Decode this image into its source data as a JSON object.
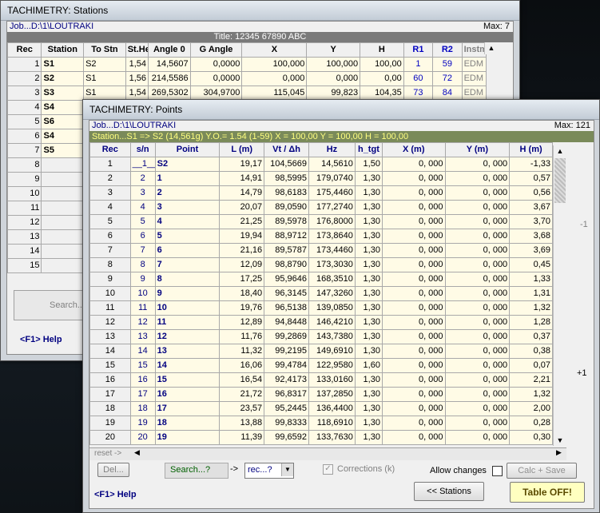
{
  "stations_window": {
    "title": "TACHIMETRY: Stations",
    "job": "Job...D:\\1\\LOUTRAKI",
    "max": "Max: 7",
    "title_line": "Title:  12345 67890 ABC",
    "headers": [
      "Rec",
      "Station",
      "To Stn",
      "St.He",
      "Angle 0",
      "G Angle",
      "X",
      "Y",
      "H",
      "R1",
      "R2",
      "Instm"
    ],
    "rows": [
      {
        "rec": "1",
        "station": "S1",
        "to_stn": "S2",
        "st_he": "1,54",
        "angle0": "14,5607",
        "g_angle": "0,0000",
        "x": "100,000",
        "y": "100,000",
        "h": "100,00",
        "r1": "1",
        "r2": "59",
        "instm": "EDM"
      },
      {
        "rec": "2",
        "station": "S2",
        "to_stn": "S1",
        "st_he": "1,56",
        "angle0": "214,5586",
        "g_angle": "0,0000",
        "x": "0,000",
        "y": "0,000",
        "h": "0,00",
        "r1": "60",
        "r2": "72",
        "instm": "EDM"
      },
      {
        "rec": "3",
        "station": "S3",
        "to_stn": "S1",
        "st_he": "1,54",
        "angle0": "269,5302",
        "g_angle": "304,9700",
        "x": "115,045",
        "y": "99,823",
        "h": "104,35",
        "r1": "73",
        "r2": "84",
        "instm": "EDM"
      },
      {
        "rec": "4",
        "station": "S4",
        "to_stn": "",
        "st_he": "",
        "angle0": "",
        "g_angle": "",
        "x": "",
        "y": "",
        "h": "",
        "r1": "",
        "r2": "",
        "instm": ""
      },
      {
        "rec": "5",
        "station": "S6",
        "to_stn": "",
        "st_he": "",
        "angle0": "",
        "g_angle": "",
        "x": "",
        "y": "",
        "h": "",
        "r1": "",
        "r2": "",
        "instm": ""
      },
      {
        "rec": "6",
        "station": "S4",
        "to_stn": "",
        "st_he": "",
        "angle0": "",
        "g_angle": "",
        "x": "",
        "y": "",
        "h": "",
        "r1": "",
        "r2": "",
        "instm": ""
      },
      {
        "rec": "7",
        "station": "S5",
        "to_stn": "",
        "st_he": "",
        "angle0": "",
        "g_angle": "",
        "x": "",
        "y": "",
        "h": "",
        "r1": "",
        "r2": "",
        "instm": ""
      },
      {
        "rec": "8",
        "station": "",
        "to_stn": "",
        "st_he": "",
        "angle0": "",
        "g_angle": "",
        "x": "",
        "y": "",
        "h": "",
        "r1": "",
        "r2": "",
        "instm": ""
      },
      {
        "rec": "9",
        "station": "",
        "to_stn": "",
        "st_he": "",
        "angle0": "",
        "g_angle": "",
        "x": "",
        "y": "",
        "h": "",
        "r1": "",
        "r2": "",
        "instm": ""
      },
      {
        "rec": "10",
        "station": "",
        "to_stn": "",
        "st_he": "",
        "angle0": "",
        "g_angle": "",
        "x": "",
        "y": "",
        "h": "",
        "r1": "",
        "r2": "",
        "instm": ""
      },
      {
        "rec": "11",
        "station": "",
        "to_stn": "",
        "st_he": "",
        "angle0": "",
        "g_angle": "",
        "x": "",
        "y": "",
        "h": "",
        "r1": "",
        "r2": "",
        "instm": ""
      },
      {
        "rec": "12",
        "station": "",
        "to_stn": "",
        "st_he": "",
        "angle0": "",
        "g_angle": "",
        "x": "",
        "y": "",
        "h": "",
        "r1": "",
        "r2": "",
        "instm": ""
      },
      {
        "rec": "13",
        "station": "",
        "to_stn": "",
        "st_he": "",
        "angle0": "",
        "g_angle": "",
        "x": "",
        "y": "",
        "h": "",
        "r1": "",
        "r2": "",
        "instm": ""
      },
      {
        "rec": "14",
        "station": "",
        "to_stn": "",
        "st_he": "",
        "angle0": "",
        "g_angle": "",
        "x": "",
        "y": "",
        "h": "",
        "r1": "",
        "r2": "",
        "instm": ""
      },
      {
        "rec": "15",
        "station": "",
        "to_stn": "",
        "st_he": "",
        "angle0": "",
        "g_angle": "",
        "x": "",
        "y": "",
        "h": "",
        "r1": "",
        "r2": "",
        "instm": ""
      }
    ],
    "search_placeholder": "Search...",
    "help": "<F1> Help"
  },
  "points_window": {
    "title": "TACHIMETRY: Points",
    "job": "Job...D:\\1\\LOUTRAKI",
    "max": "Max: 121",
    "station_line": "Station...S1 => S2 (14,561g)   Y.O.= 1.54  (1-59)   X = 100,00  Y = 100,00   H = 100,00",
    "headers": [
      "Rec",
      "s/n",
      "Point",
      "L (m)",
      "Vt / Δh",
      "Hz",
      "h_tgt",
      "X  (m)",
      "Y  (m)",
      "H  (m)"
    ],
    "rows": [
      {
        "rec": "1",
        "sn": "__1__",
        "point": "S2",
        "l": "19,17",
        "vt": "104,5669",
        "hz": "14,5610",
        "htgt": "1,50",
        "x": "0, 000",
        "y": "0, 000",
        "h": "-1,33"
      },
      {
        "rec": "2",
        "sn": "2",
        "point": "1",
        "l": "14,91",
        "vt": "98,5995",
        "hz": "179,0740",
        "htgt": "1,30",
        "x": "0, 000",
        "y": "0, 000",
        "h": "0,57"
      },
      {
        "rec": "3",
        "sn": "3",
        "point": "2",
        "l": "14,79",
        "vt": "98,6183",
        "hz": "175,4460",
        "htgt": "1,30",
        "x": "0, 000",
        "y": "0, 000",
        "h": "0,56"
      },
      {
        "rec": "4",
        "sn": "4",
        "point": "3",
        "l": "20,07",
        "vt": "89,0590",
        "hz": "177,2740",
        "htgt": "1,30",
        "x": "0, 000",
        "y": "0, 000",
        "h": "3,67"
      },
      {
        "rec": "5",
        "sn": "5",
        "point": "4",
        "l": "21,25",
        "vt": "89,5978",
        "hz": "176,8000",
        "htgt": "1,30",
        "x": "0, 000",
        "y": "0, 000",
        "h": "3,70"
      },
      {
        "rec": "6",
        "sn": "6",
        "point": "5",
        "l": "19,94",
        "vt": "88,9712",
        "hz": "173,8640",
        "htgt": "1,30",
        "x": "0, 000",
        "y": "0, 000",
        "h": "3,68"
      },
      {
        "rec": "7",
        "sn": "7",
        "point": "6",
        "l": "21,16",
        "vt": "89,5787",
        "hz": "173,4460",
        "htgt": "1,30",
        "x": "0, 000",
        "y": "0, 000",
        "h": "3,69"
      },
      {
        "rec": "8",
        "sn": "8",
        "point": "7",
        "l": "12,09",
        "vt": "98,8790",
        "hz": "173,3030",
        "htgt": "1,30",
        "x": "0, 000",
        "y": "0, 000",
        "h": "0,45"
      },
      {
        "rec": "9",
        "sn": "9",
        "point": "8",
        "l": "17,25",
        "vt": "95,9646",
        "hz": "168,3510",
        "htgt": "1,30",
        "x": "0, 000",
        "y": "0, 000",
        "h": "1,33"
      },
      {
        "rec": "10",
        "sn": "10",
        "point": "9",
        "l": "18,40",
        "vt": "96,3145",
        "hz": "147,3260",
        "htgt": "1,30",
        "x": "0, 000",
        "y": "0, 000",
        "h": "1,31"
      },
      {
        "rec": "11",
        "sn": "11",
        "point": "10",
        "l": "19,76",
        "vt": "96,5138",
        "hz": "139,0850",
        "htgt": "1,30",
        "x": "0, 000",
        "y": "0, 000",
        "h": "1,32"
      },
      {
        "rec": "12",
        "sn": "12",
        "point": "11",
        "l": "12,89",
        "vt": "94,8448",
        "hz": "146,4210",
        "htgt": "1,30",
        "x": "0, 000",
        "y": "0, 000",
        "h": "1,28"
      },
      {
        "rec": "13",
        "sn": "13",
        "point": "12",
        "l": "11,76",
        "vt": "99,2869",
        "hz": "143,7380",
        "htgt": "1,30",
        "x": "0, 000",
        "y": "0, 000",
        "h": "0,37"
      },
      {
        "rec": "14",
        "sn": "14",
        "point": "13",
        "l": "11,32",
        "vt": "99,2195",
        "hz": "149,6910",
        "htgt": "1,30",
        "x": "0, 000",
        "y": "0, 000",
        "h": "0,38"
      },
      {
        "rec": "15",
        "sn": "15",
        "point": "14",
        "l": "16,06",
        "vt": "99,4784",
        "hz": "122,9580",
        "htgt": "1,60",
        "x": "0, 000",
        "y": "0, 000",
        "h": "0,07"
      },
      {
        "rec": "16",
        "sn": "16",
        "point": "15",
        "l": "16,54",
        "vt": "92,4173",
        "hz": "133,0160",
        "htgt": "1,30",
        "x": "0, 000",
        "y": "0, 000",
        "h": "2,21"
      },
      {
        "rec": "17",
        "sn": "17",
        "point": "16",
        "l": "21,72",
        "vt": "96,8317",
        "hz": "137,2850",
        "htgt": "1,30",
        "x": "0, 000",
        "y": "0, 000",
        "h": "1,32"
      },
      {
        "rec": "18",
        "sn": "18",
        "point": "17",
        "l": "23,57",
        "vt": "95,2445",
        "hz": "136,4400",
        "htgt": "1,30",
        "x": "0, 000",
        "y": "0, 000",
        "h": "2,00"
      },
      {
        "rec": "19",
        "sn": "19",
        "point": "18",
        "l": "13,88",
        "vt": "99,8333",
        "hz": "118,6910",
        "htgt": "1,30",
        "x": "0, 000",
        "y": "0, 000",
        "h": "0,28"
      },
      {
        "rec": "20",
        "sn": "20",
        "point": "19",
        "l": "11,39",
        "vt": "99,6592",
        "hz": "133,7630",
        "htgt": "1,30",
        "x": "0, 000",
        "y": "0, 000",
        "h": "0,30"
      }
    ],
    "reset_label": "reset ->",
    "side_minus": "-1",
    "side_plus": "+1",
    "del_label": "Del...",
    "search_label": "Search...?",
    "arrow_label": "->",
    "rec_select": "rec...?",
    "corrections_label": "Corrections (k)",
    "allow_changes_label": "Allow changes",
    "calc_save_label": "Calc + Save",
    "help": "<F1> Help",
    "stations_btn": "<< Stations",
    "table_off_btn": "Table OFF!"
  },
  "colors": {
    "cell_bg": "#fffbe6",
    "navy": "#000080",
    "table_off_bg": "#ffffc0"
  }
}
